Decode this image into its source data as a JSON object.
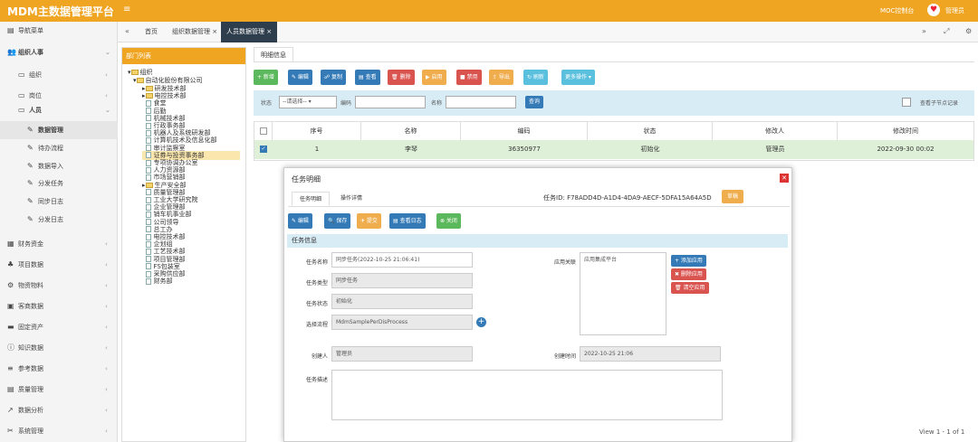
{
  "app": {
    "title": "MDM主数据管理平台",
    "menu_toggle": "≡",
    "moc_switch": "MOC控制台",
    "avatar_icon": "♥",
    "username": "管理员"
  },
  "sidebar": {
    "nav_header": "导航菜单",
    "items": [
      {
        "label": "组织人事",
        "icon": "👥"
      },
      {
        "label": "组织",
        "icon": "▭"
      },
      {
        "label": "岗位",
        "icon": "▭"
      },
      {
        "label": "人员",
        "icon": "▭"
      },
      {
        "label": "数据管理",
        "icon": "✎"
      },
      {
        "label": "待办流程",
        "icon": "✎"
      },
      {
        "label": "数据导入",
        "icon": "✎"
      },
      {
        "label": "分发任务",
        "icon": "✎"
      },
      {
        "label": "同步日志",
        "icon": "✎"
      },
      {
        "label": "分发日志",
        "icon": "✎"
      },
      {
        "label": "财务资金",
        "icon": "▦"
      },
      {
        "label": "项目数据",
        "icon": "♣"
      },
      {
        "label": "物资物料",
        "icon": "⚙"
      },
      {
        "label": "客商数据",
        "icon": "▣"
      },
      {
        "label": "固定资产",
        "icon": "▬"
      },
      {
        "label": "知识数据",
        "icon": "ⓘ"
      },
      {
        "label": "参考数据",
        "icon": "≡"
      },
      {
        "label": "质量管理",
        "icon": "▤"
      },
      {
        "label": "数据分析",
        "icon": "↗"
      },
      {
        "label": "系统管理",
        "icon": "✂"
      }
    ]
  },
  "tabs": {
    "back": "«",
    "home": "首页",
    "t1": "组织数据管理 ×",
    "t2": "人员数据管理 ×",
    "right_nav": "»",
    "expand": "⤢",
    "settings": "⚙"
  },
  "tree": {
    "header": "部门列表",
    "root": "组织",
    "company": "自动化股份有限公司",
    "nodes": [
      "研发技术部",
      "电控技术部",
      "食堂",
      "后勤",
      "机械技术部",
      "行政事务部",
      "机器人及系统研发部",
      "计算机技术及信息化部",
      "审计监察室",
      "证券与投资事务部",
      "专项协调办公室",
      "人力资源部",
      "市场营销部",
      "生产安全部",
      "质量管理部",
      "工业大学研究院",
      "企业管理部",
      "销车机事业部",
      "公司领导",
      "总工办",
      "电控技术部",
      "企划组",
      "工艺技术部",
      "项目管理部",
      "FS包装室",
      "采购供应部",
      "财务部"
    ]
  },
  "main": {
    "subtab": "明细信息",
    "buttons": [
      {
        "label": "+ 新增",
        "color": "#5cb85c"
      },
      {
        "label": "✎ 编辑",
        "color": "#337ab7"
      },
      {
        "label": "☍ 复制",
        "color": "#337ab7"
      },
      {
        "label": "▤ 查看",
        "color": "#337ab7"
      },
      {
        "label": "🗑 删除",
        "color": "#d9534f"
      },
      {
        "label": "▶ 启用",
        "color": "#f0ad4e"
      },
      {
        "label": "■ 禁用",
        "color": "#d9534f"
      },
      {
        "label": "⇪ 导出",
        "color": "#f0ad4e"
      },
      {
        "label": "↻ 刷新",
        "color": "#5bc0de"
      },
      {
        "label": "更多操作 ▾",
        "color": "#5bc0de"
      }
    ],
    "filter": {
      "status_label": "状态",
      "status_value": "--请选择--",
      "code_label": "编码",
      "name_label": "名称",
      "query": "查询",
      "subnode": "查看子节点记录"
    },
    "grid": {
      "headers": [
        "序号",
        "名称",
        "编码",
        "状态",
        "修改人",
        "修改时间"
      ],
      "rows": [
        {
          "index": "1",
          "name": "李琴",
          "code": "36350977",
          "status": "初始化",
          "modifier": "管理员",
          "time": "2022-09-30 00:02"
        }
      ]
    },
    "pager": "View 1 - 1 of 1"
  },
  "modal": {
    "title": "任务明细",
    "close": "✕",
    "tabs": [
      "任务明细",
      "操作详情"
    ],
    "task_id_label": "任务ID:",
    "task_id": "F78ADD4D-A1D4-4DA9-AECF-5DFA15A64A5D",
    "badge": "草稿",
    "buttons": [
      {
        "label": "✎ 编辑",
        "color": "#337ab7"
      },
      {
        "label": "🔍 保存",
        "color": "#337ab7"
      },
      {
        "label": "✈ 提交",
        "color": "#f0ad4e"
      },
      {
        "label": "▤ 查看日志",
        "color": "#337ab7"
      },
      {
        "label": "⊗ 关闭",
        "color": "#5cb85c"
      }
    ],
    "info_header": "任务信息",
    "fields": {
      "name_label": "任务名称",
      "name_value": "同步任务(2022-10-25 21:06:41)",
      "type_label": "任务类型",
      "type_value": "同步任务",
      "status_label": "任务状态",
      "status_value": "初始化",
      "flow_label": "选择流程",
      "flow_value": "MdmSamplePerDisProcess",
      "creator_label": "创建人",
      "creator_value": "管理员",
      "desc_label": "任务描述",
      "app_label": "应用关联",
      "app_value": "应用集成平台",
      "created_label": "创建时间",
      "created_value": "2022-10-25 21:06"
    },
    "app_buttons": [
      {
        "label": "+ 添加应用",
        "color": "#337ab7"
      },
      {
        "label": "✖ 删除应用",
        "color": "#d9534f"
      },
      {
        "label": "🗑 清空应用",
        "color": "#d9534f"
      }
    ]
  }
}
